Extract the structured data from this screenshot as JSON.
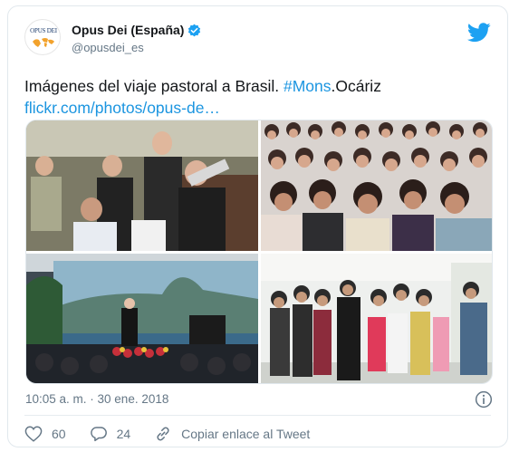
{
  "account": {
    "display_name": "Opus Dei (España)",
    "handle": "@opusdei_es",
    "avatar_text": "OPUS DEI"
  },
  "tweet": {
    "text_prefix": "Imágenes del viaje pastoral a Brasil. ",
    "hashtag": "#Mons",
    "text_suffix": ".Ocáriz",
    "link": "flickr.com/photos/opus-de…"
  },
  "media": {
    "photos": [
      {
        "description": "Men in a room"
      },
      {
        "description": "Audience of women"
      },
      {
        "description": "Event on stage"
      },
      {
        "description": "Group photo with children"
      }
    ]
  },
  "meta": {
    "timestamp": "10:05 a. m. · 30 ene. 2018"
  },
  "actions": {
    "likes": "60",
    "replies": "24",
    "copy_link_label": "Copiar enlace al Tweet"
  },
  "colors": {
    "accent": "#1da1f2",
    "link": "#1b95e0",
    "muted": "#657786"
  }
}
